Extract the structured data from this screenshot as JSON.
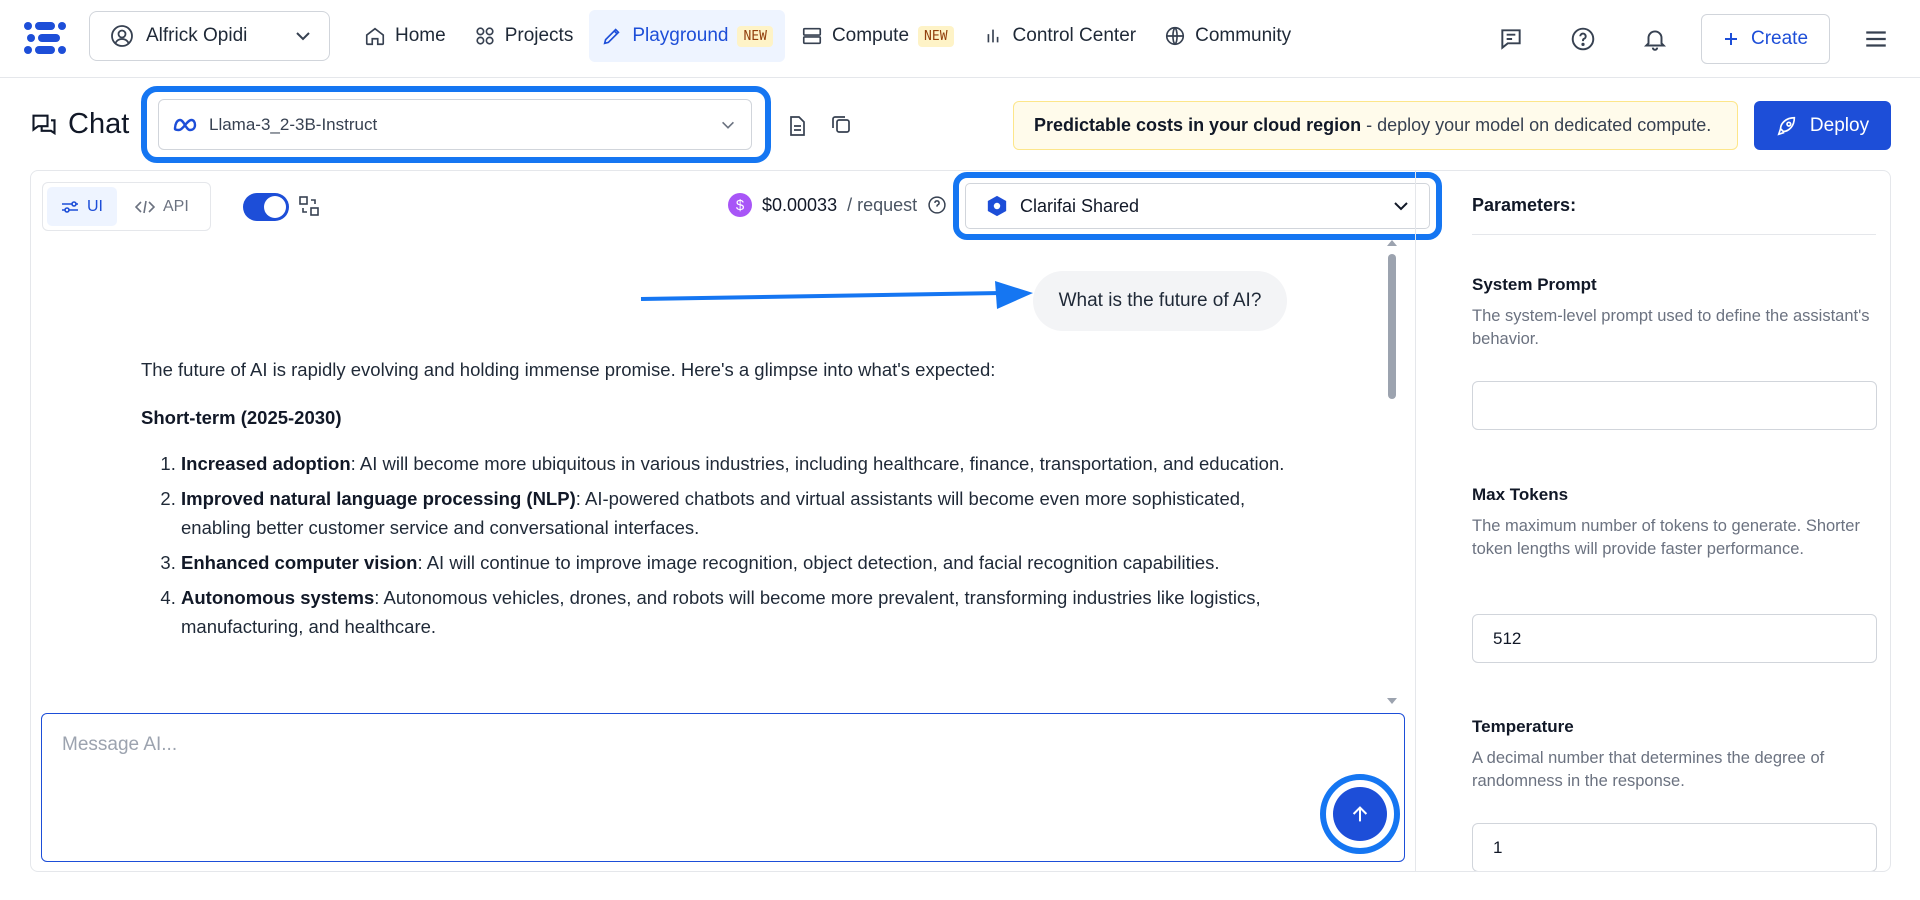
{
  "nav": {
    "account_name": "Alfrick Opidi",
    "links": [
      {
        "label": "Home",
        "icon": "home-icon"
      },
      {
        "label": "Projects",
        "icon": "projects-icon"
      },
      {
        "label": "Playground",
        "icon": "playground-icon",
        "badge": "NEW",
        "active": true
      },
      {
        "label": "Compute",
        "icon": "compute-icon",
        "badge": "NEW"
      },
      {
        "label": "Control Center",
        "icon": "chart-icon"
      },
      {
        "label": "Community",
        "icon": "globe-icon"
      }
    ],
    "create_label": "Create"
  },
  "header": {
    "title": "Chat",
    "model": "Llama-3_2-3B-Instruct",
    "banner_bold": "Predictable costs in your cloud region",
    "banner_rest": " - deploy your model on dedicated compute.",
    "deploy_label": "Deploy"
  },
  "toolbar": {
    "ui_label": "UI",
    "api_label": "API",
    "toggle_on": true,
    "price": "$0.00033",
    "price_unit": "/ request",
    "compute": "Clarifai Shared"
  },
  "conversation": {
    "user_message": "What is the future of AI?",
    "intro": "The future of AI is rapidly evolving and holding immense promise. Here's a glimpse into what's expected:",
    "section": "Short-term (2025-2030)",
    "items": [
      {
        "title": "Increased adoption",
        "text": ": AI will become more ubiquitous in various industries, including healthcare, finance, transportation, and education."
      },
      {
        "title": "Improved natural language processing (NLP)",
        "text": ": AI-powered chatbots and virtual assistants will become even more sophisticated, enabling better customer service and conversational interfaces."
      },
      {
        "title": "Enhanced computer vision",
        "text": ": AI will continue to improve image recognition, object detection, and facial recognition capabilities."
      },
      {
        "title": "Autonomous systems",
        "text": ": Autonomous vehicles, drones, and robots will become more prevalent, transforming industries like logistics, manufacturing, and healthcare."
      }
    ]
  },
  "composer": {
    "placeholder": "Message AI..."
  },
  "params": {
    "heading": "Parameters:",
    "system_prompt": {
      "label": "System Prompt",
      "desc": "The system-level prompt used to define the assistant's behavior.",
      "value": ""
    },
    "max_tokens": {
      "label": "Max Tokens",
      "desc": "The maximum number of tokens to generate. Shorter token lengths will provide faster performance.",
      "value": "512"
    },
    "temperature": {
      "label": "Temperature",
      "desc": "A decimal number that determines the degree of randomness in the response.",
      "value": "1"
    }
  },
  "colors": {
    "accent": "#1d4ed8",
    "highlight": "#1576f2",
    "banner_bg": "#fffbeb",
    "badge_bg": "#fef3c7"
  }
}
